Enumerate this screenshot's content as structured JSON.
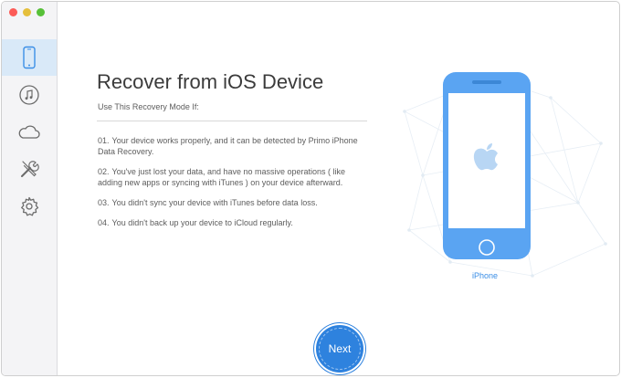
{
  "sidebar": {
    "items": [
      {
        "name": "ios-device",
        "icon": "iphone-icon",
        "active": true
      },
      {
        "name": "itunes",
        "icon": "music-note-icon",
        "active": false
      },
      {
        "name": "icloud",
        "icon": "cloud-icon",
        "active": false
      },
      {
        "name": "tools",
        "icon": "tools-icon",
        "active": false
      },
      {
        "name": "settings",
        "icon": "gear-icon",
        "active": false
      }
    ]
  },
  "main": {
    "title": "Recover from iOS Device",
    "subtitle": "Use This Recovery Mode If:",
    "items": [
      {
        "num": "01.",
        "text": "Your device works properly, and it can be detected by Primo iPhone Data Recovery."
      },
      {
        "num": "02.",
        "text": "You've just lost your data, and have no massive operations ( like adding new apps or syncing with iTunes ) on your device afterward."
      },
      {
        "num": "03.",
        "text": "You didn't sync your device with iTunes before data loss."
      },
      {
        "num": "04.",
        "text": "You didn't back up your device to iCloud regularly."
      }
    ],
    "device_label": "iPhone",
    "next_label": "Next"
  },
  "colors": {
    "accent": "#2e82de",
    "phone_body": "#5aa4f2",
    "sidebar_active": "#d9e9f8"
  }
}
